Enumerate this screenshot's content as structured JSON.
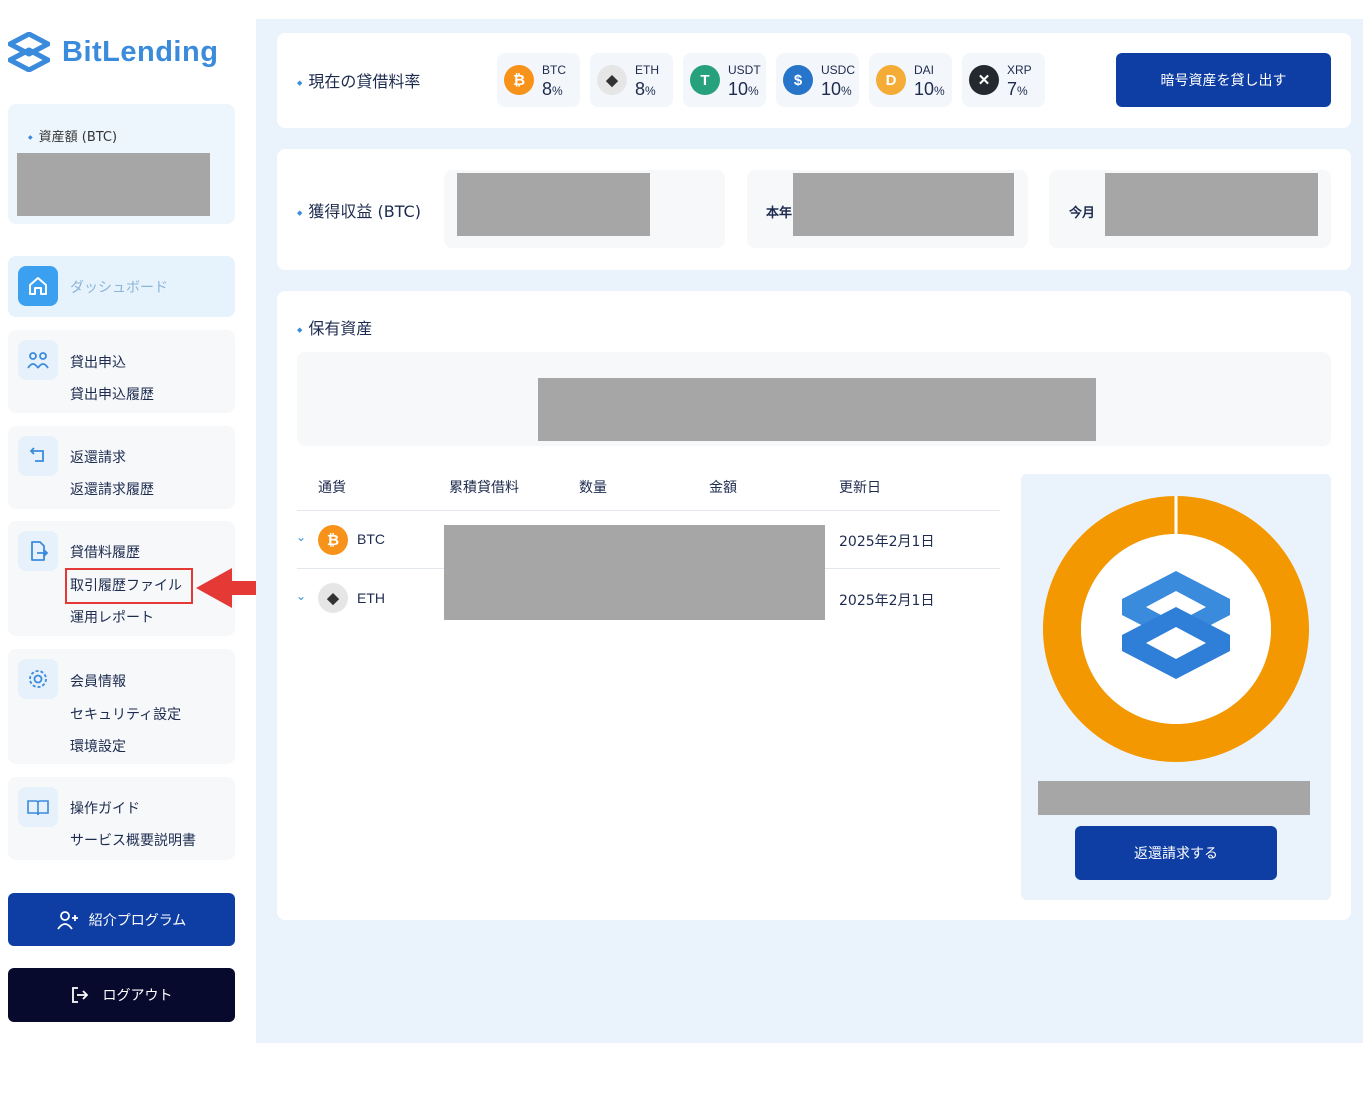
{
  "brand": {
    "name": "BitLending"
  },
  "sidebar": {
    "asset_label": "資産額 (BTC)",
    "dashboard": "ダッシュボード",
    "groups": [
      {
        "items": [
          "貸出申込",
          "貸出申込履歴"
        ]
      },
      {
        "items": [
          "返還請求",
          "返還請求履歴"
        ]
      },
      {
        "items": [
          "貸借料履歴",
          "取引履歴ファイル",
          "運用レポート"
        ]
      },
      {
        "items": [
          "会員情報",
          "セキュリティ設定",
          "環境設定"
        ]
      },
      {
        "items": [
          "操作ガイド",
          "サービス概要説明書"
        ]
      }
    ],
    "referral_button": "紹介プログラム",
    "logout_button": "ログアウト",
    "highlighted_item": "取引履歴ファイル"
  },
  "rates": {
    "title": "現在の貸借料率",
    "items": [
      {
        "symbol": "BTC",
        "value": "8",
        "unit": "%",
        "icon": "bitcoin-icon",
        "color": "#f7931a",
        "glyph": "₿"
      },
      {
        "symbol": "ETH",
        "value": "8",
        "unit": "%",
        "icon": "ethereum-icon",
        "color": "#e6e6e6",
        "glyph": "◆"
      },
      {
        "symbol": "USDT",
        "value": "10",
        "unit": "%",
        "icon": "tether-icon",
        "color": "#26a17b",
        "glyph": "T"
      },
      {
        "symbol": "USDC",
        "value": "10",
        "unit": "%",
        "icon": "usdc-icon",
        "color": "#2775ca",
        "glyph": "$"
      },
      {
        "symbol": "DAI",
        "value": "10",
        "unit": "%",
        "icon": "dai-icon",
        "color": "#f5ac37",
        "glyph": "D"
      },
      {
        "symbol": "XRP",
        "value": "7",
        "unit": "%",
        "icon": "xrp-icon",
        "color": "#23292f",
        "glyph": "✕"
      }
    ],
    "lend_button": "暗号資産を貸し出す"
  },
  "earnings": {
    "title": "獲得収益 (BTC)",
    "this_year_label": "本年",
    "this_month_label": "今月"
  },
  "holdings": {
    "title": "保有資産",
    "columns": [
      "通貨",
      "累積貸借料",
      "数量",
      "金額",
      "更新日"
    ],
    "rows": [
      {
        "coin": "BTC",
        "updated": "2025年2月1日"
      },
      {
        "coin": "ETH",
        "updated": "2025年2月1日"
      }
    ],
    "repay_button": "返還請求する"
  },
  "colors": {
    "primary": "#0e3ea3",
    "accent": "#3b8bdc",
    "donut": "#f39800",
    "highlight": "#e53935"
  }
}
